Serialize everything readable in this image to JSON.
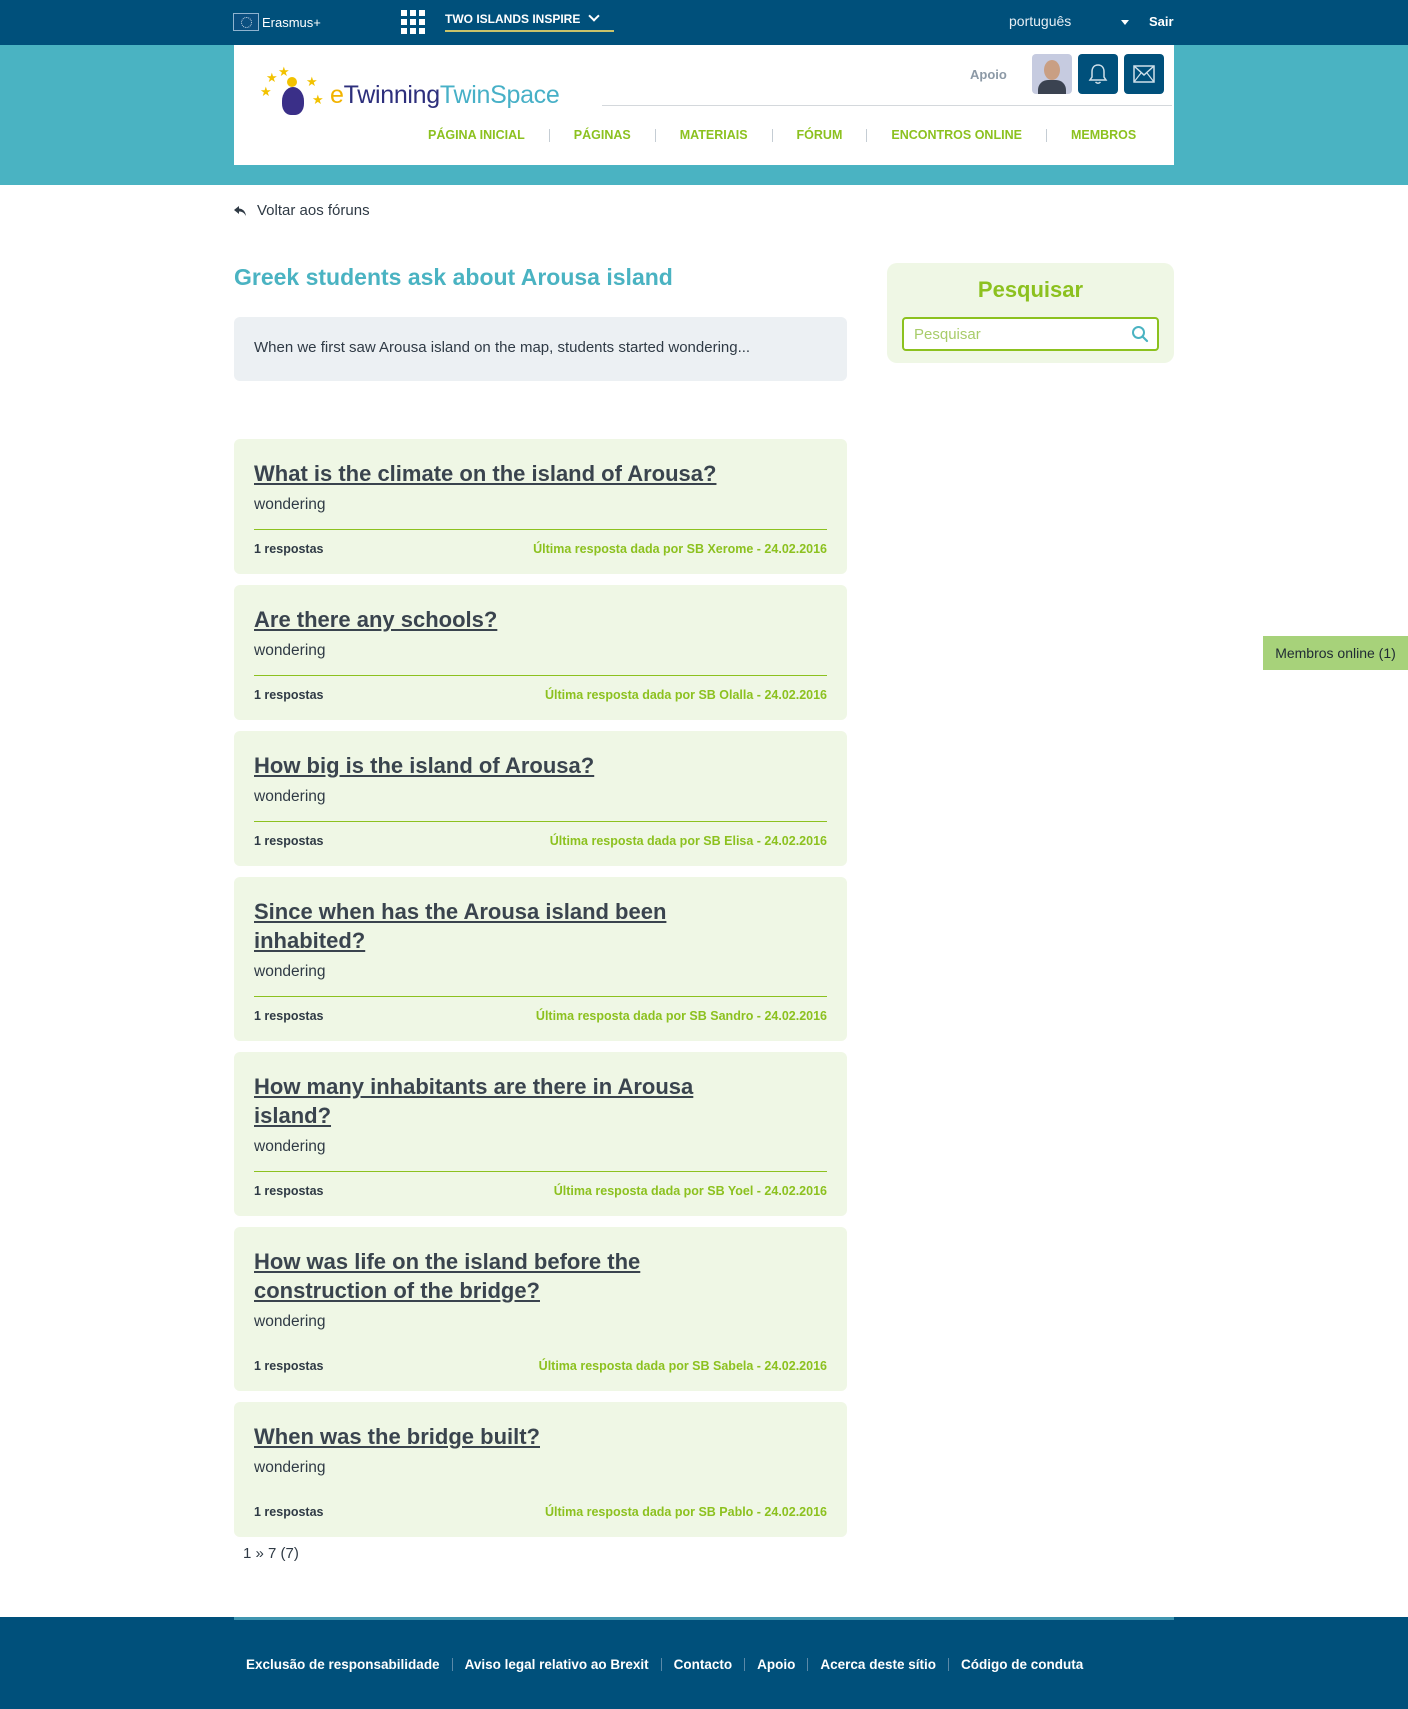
{
  "topbar": {
    "erasmus_label": "Erasmus+",
    "apps_icon": "apps-grid-icon",
    "project_name": "TWO ISLANDS INSPIRE",
    "language": "português",
    "logout_label": "Sair"
  },
  "header": {
    "logo": {
      "e": "e",
      "twinning": "Twinning",
      "twinspace": "TwinSpace"
    },
    "support_label": "Apoio",
    "icons": {
      "notifications": "bell-icon",
      "messages": "mail-icon"
    },
    "nav": [
      "PÁGINA INICIAL",
      "PÁGINAS",
      "MATERIAIS",
      "FÓRUM",
      "ENCONTROS ONLINE",
      "MEMBROS"
    ]
  },
  "main": {
    "back_label": "Voltar aos fóruns",
    "title": "Greek students ask about Arousa island",
    "intro": "When we first saw Arousa island on the map, students started wondering...",
    "topics": [
      {
        "title": "What is the climate on the island of Arousa?",
        "desc": "wondering",
        "replies": "1 respostas",
        "last": "Última resposta dada por SB Xerome - 24.02.2016"
      },
      {
        "title": "Are there any schools?",
        "desc": "wondering",
        "replies": "1 respostas",
        "last": "Última resposta dada por SB Olalla - 24.02.2016"
      },
      {
        "title": "How big is the island of Arousa?",
        "desc": "wondering",
        "replies": "1 respostas",
        "last": "Última resposta dada por SB Elisa - 24.02.2016"
      },
      {
        "title": "Since when has the Arousa island been inhabited?",
        "desc": "wondering",
        "replies": "1 respostas",
        "last": "Última resposta dada por SB Sandro - 24.02.2016"
      },
      {
        "title": "How many inhabitants are there in Arousa island?",
        "desc": "wondering",
        "replies": "1 respostas",
        "last": "Última resposta dada por SB Yoel - 24.02.2016"
      },
      {
        "title": "How was life on the island before the construction of the bridge?",
        "desc": "wondering",
        "replies": "1 respostas",
        "last": "Última resposta dada por SB Sabela - 24.02.2016"
      },
      {
        "title": "When was the bridge built?",
        "desc": "wondering",
        "replies": "1 respostas",
        "last": "Última resposta dada por SB Pablo - 24.02.2016"
      }
    ],
    "pager": "1 » 7 (7)"
  },
  "sidebar": {
    "search_title": "Pesquisar",
    "search_placeholder": "Pesquisar",
    "search_icon": "search-icon"
  },
  "online_members_label": "Membros online (1)",
  "footer": {
    "links": [
      "Exclusão de responsabilidade",
      "Aviso legal relativo ao Brexit",
      "Contacto",
      "Apoio",
      "Acerca deste sítio",
      "Código de conduta"
    ]
  },
  "colors": {
    "dark_blue": "#00507b",
    "teal": "#4ab3c2",
    "green": "#8cc11f",
    "topic_bg": "#eff7e5"
  }
}
